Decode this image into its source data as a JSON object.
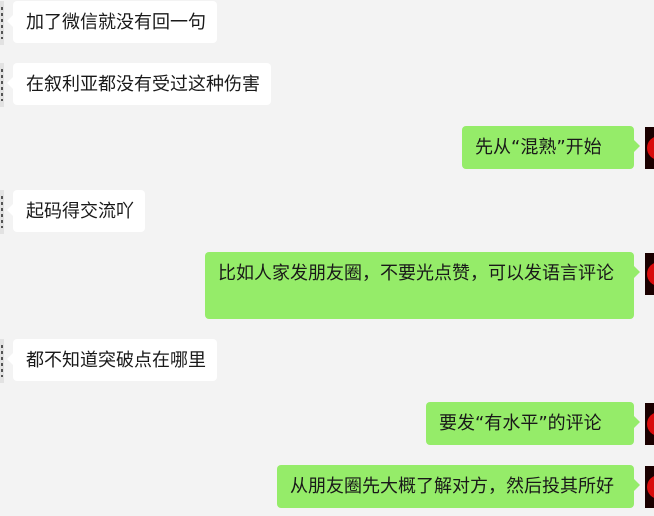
{
  "messages": [
    {
      "side": "left",
      "text": "加了微信就没有回一句"
    },
    {
      "side": "left",
      "text": "在叙利亚都没有受过这种伤害"
    },
    {
      "side": "right",
      "text": "先从“混熟”开始"
    },
    {
      "side": "left",
      "text": "起码得交流吖"
    },
    {
      "side": "right",
      "text": "比如人家发朋友圈，不要光点赞，可以发语言评论"
    },
    {
      "side": "left",
      "text": "都不知道突破点在哪里"
    },
    {
      "side": "right",
      "text": "要发“有水平”的评论"
    },
    {
      "side": "right",
      "text": "从朋友圈先大概了解对方，然后投其所好"
    }
  ],
  "colors": {
    "background": "#f3f3f3",
    "incoming_bubble": "#ffffff",
    "outgoing_bubble": "#95ec69",
    "text": "#191919"
  }
}
